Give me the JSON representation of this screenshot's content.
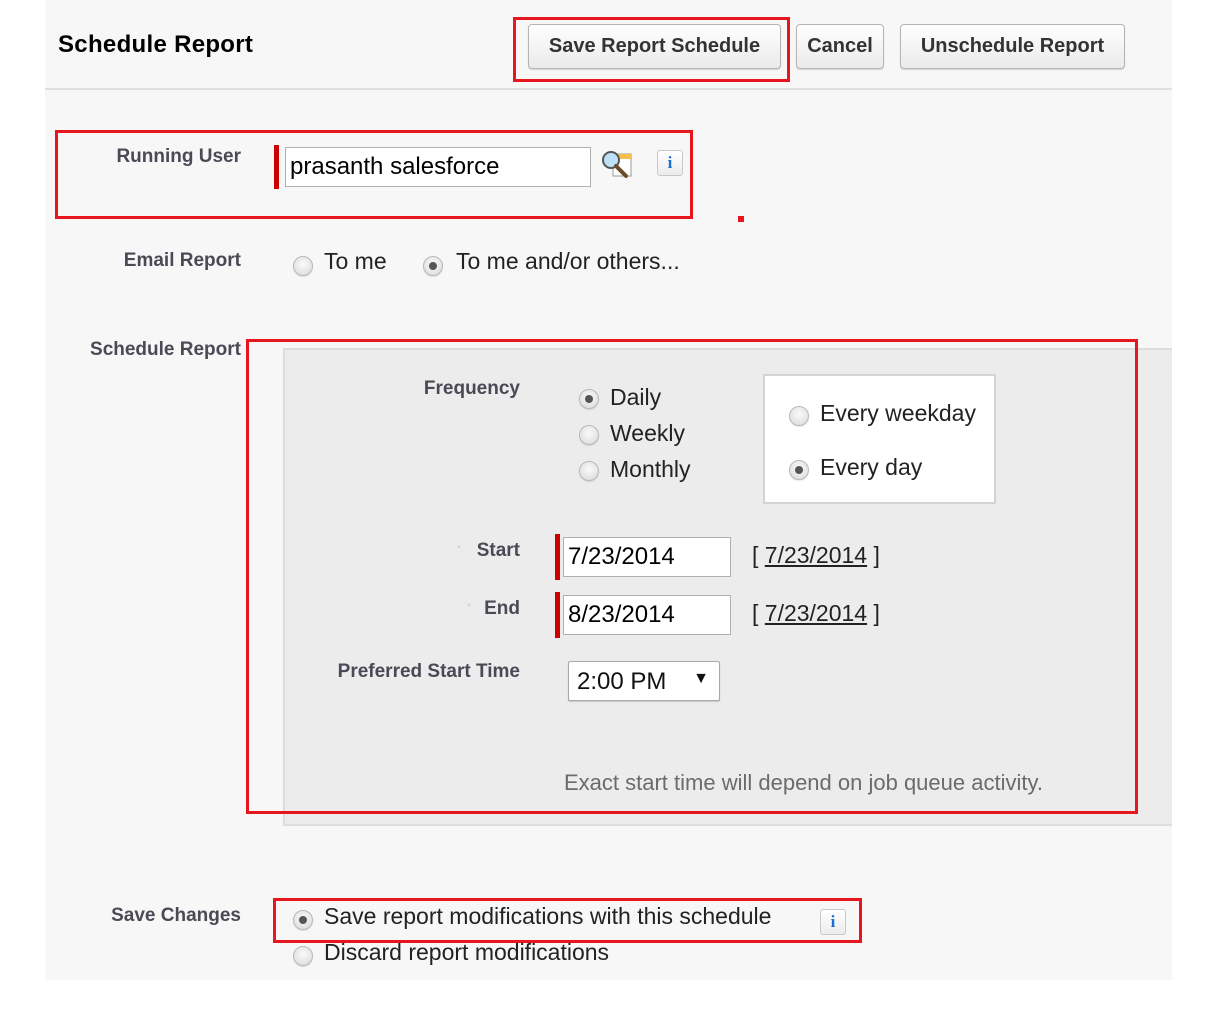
{
  "header": {
    "title": "Schedule Report",
    "buttons": {
      "save": "Save Report Schedule",
      "cancel": "Cancel",
      "unschedule": "Unschedule Report"
    }
  },
  "running_user": {
    "label": "Running User",
    "value": "prasanth salesforce",
    "lookup_icon": "lookup-magnifier-icon",
    "info_icon": "i"
  },
  "email_report": {
    "label": "Email Report",
    "options": [
      {
        "label": "To me",
        "checked": false
      },
      {
        "label": "To me and/or others...",
        "checked": true
      }
    ]
  },
  "schedule": {
    "label": "Schedule Report",
    "frequency": {
      "label": "Frequency",
      "options": [
        {
          "label": "Daily",
          "checked": true
        },
        {
          "label": "Weekly",
          "checked": false
        },
        {
          "label": "Monthly",
          "checked": false
        }
      ],
      "daily_options": [
        {
          "label": "Every weekday",
          "checked": false
        },
        {
          "label": "Every day",
          "checked": true
        }
      ]
    },
    "start": {
      "label": "Start",
      "value": "7/23/2014",
      "today_link": "7/23/2014"
    },
    "end": {
      "label": "End",
      "value": "8/23/2014",
      "today_link": "7/23/2014"
    },
    "preferred_start_time": {
      "label": "Preferred Start Time",
      "value": "2:00 PM"
    },
    "note": "Exact start time will depend on job queue activity."
  },
  "save_changes": {
    "label": "Save Changes",
    "options": [
      {
        "label": "Save report modifications with this schedule",
        "checked": true
      },
      {
        "label": "Discard report modifications",
        "checked": false
      }
    ],
    "info_icon": "i"
  },
  "annotation_color": "#e8141e"
}
